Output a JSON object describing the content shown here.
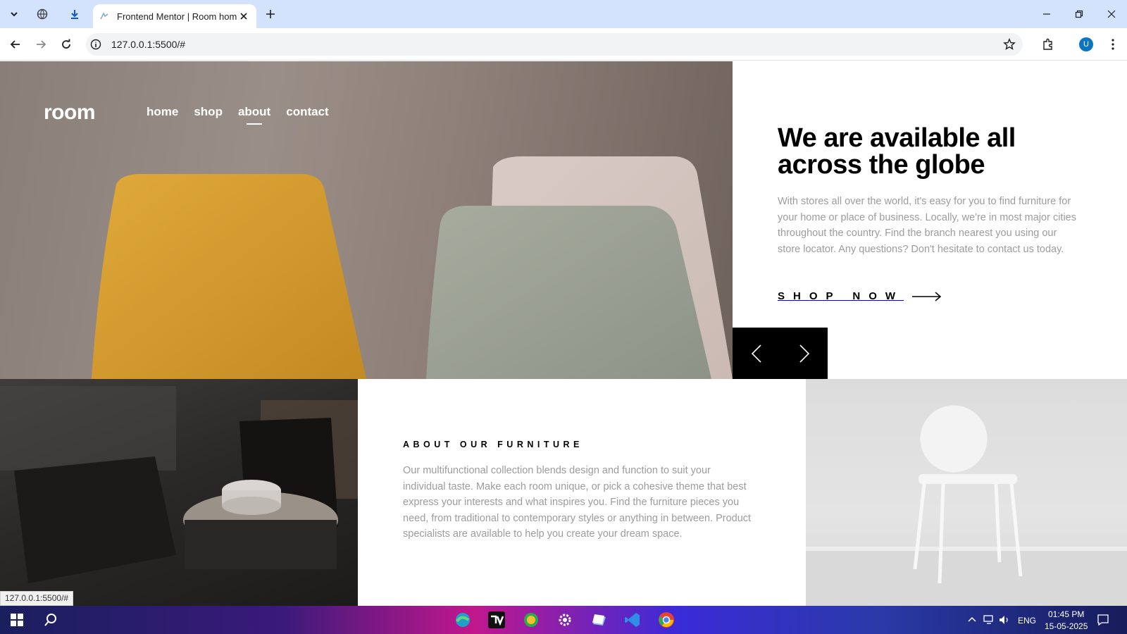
{
  "browser": {
    "tab_title": "Frontend Mentor | Room homepage",
    "url": "127.0.0.1:5500/#",
    "profile_initial": "U",
    "status_url": "127.0.0.1:5500/#"
  },
  "site": {
    "logo": "room",
    "nav": [
      {
        "label": "home",
        "active": false
      },
      {
        "label": "shop",
        "active": false
      },
      {
        "label": "about",
        "active": true
      },
      {
        "label": "contact",
        "active": false
      }
    ],
    "hero": {
      "title_line1": "We are available all",
      "title_line2": "across the globe",
      "description": "With stores all over the world, it's easy for you to find furniture for your home or place of business. Locally, we're in most major cities throughout the country. Find the branch nearest you using our store locator. Any questions? Don't hesitate to contact us today.",
      "cta": "SHOP NOW"
    },
    "about": {
      "title": "ABOUT OUR FURNITURE",
      "description": "Our multifunctional collection blends design and function to suit your individual taste. Make each room unique, or pick a cohesive theme that best express your interests and what inspires you. Find the furniture pieces you need, from traditional to contemporary styles or anything in between. Product specialists are available to help you create your dream space."
    }
  },
  "taskbar": {
    "language": "ENG",
    "time": "01:45 PM",
    "date": "15-05-2025"
  }
}
